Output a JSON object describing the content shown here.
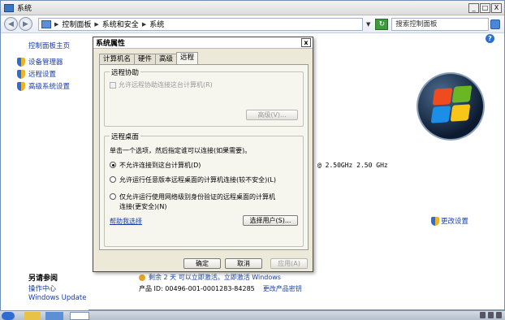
{
  "window": {
    "title": "系统",
    "breadcrumb": [
      "控制面板",
      "系统和安全",
      "系统"
    ],
    "search_placeholder": "搜索控制面板",
    "controls": {
      "minimize": "_",
      "maximize": "□",
      "close": "X"
    }
  },
  "sidebar": {
    "home": "控制面板主页",
    "items": [
      "设备管理器",
      "远程设置",
      "高级系统设置"
    ],
    "see_also_title": "另请参阅",
    "see_also": [
      "操作中心",
      "Windows Update"
    ]
  },
  "main": {
    "cpu_speed": "@ 2.50GHz   2.50 GHz",
    "change_settings": "更改设置",
    "activation_text": "剩余 2 天 可以立即激活。立即激活 Windows",
    "product_id_label": "产品 ID: 00496-001-0001283-84285",
    "change_product_key": "更改产品密钥"
  },
  "dialog": {
    "title": "系统属性",
    "close": "x",
    "tabs": [
      "计算机名",
      "硬件",
      "高级",
      "远程"
    ],
    "active_tab": 3,
    "remote_assistance": {
      "group_label": "远程协助",
      "checkbox_label": "允许远程协助连接这台计算机(R)",
      "advanced_button": "高级(V)..."
    },
    "remote_desktop": {
      "group_label": "远程桌面",
      "instruction": "单击一个选项，然后指定谁可以连接(如果需要)。",
      "options": [
        "不允许连接到这台计算机(D)",
        "允许运行任意版本远程桌面的计算机连接(较不安全)(L)",
        "仅允许运行使用网络级别身份验证的远程桌面的计算机",
        "连接(更安全)(N)"
      ],
      "selected_option": 0,
      "help_link": "帮助我选择",
      "select_users_button": "选择用户(S)..."
    },
    "buttons": {
      "ok": "确定",
      "cancel": "取消",
      "apply": "应用(A)"
    }
  },
  "colors": {
    "link": "#1a3fa0",
    "dialog_bg": "#ece9d8"
  }
}
